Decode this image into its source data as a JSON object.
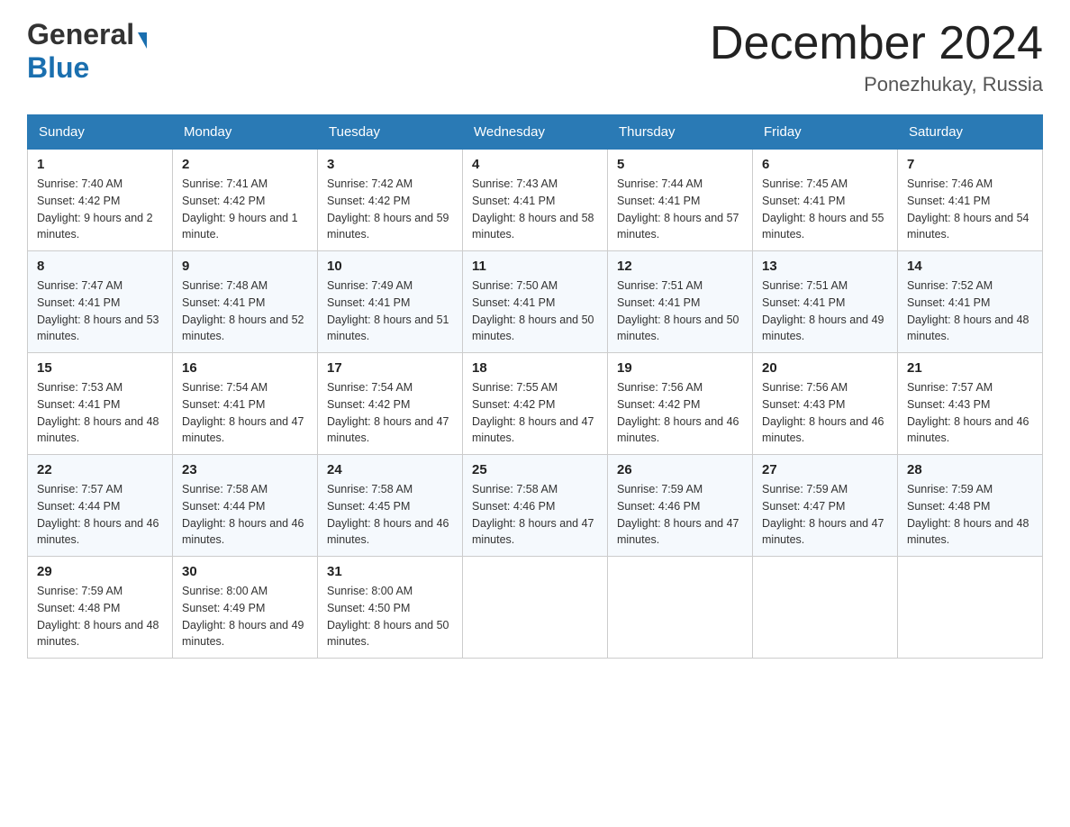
{
  "header": {
    "logo_general": "General",
    "logo_blue": "Blue",
    "month_title": "December 2024",
    "location": "Ponezhukay, Russia"
  },
  "days_of_week": [
    "Sunday",
    "Monday",
    "Tuesday",
    "Wednesday",
    "Thursday",
    "Friday",
    "Saturday"
  ],
  "weeks": [
    [
      {
        "day": "1",
        "sunrise": "7:40 AM",
        "sunset": "4:42 PM",
        "daylight": "9 hours and 2 minutes."
      },
      {
        "day": "2",
        "sunrise": "7:41 AM",
        "sunset": "4:42 PM",
        "daylight": "9 hours and 1 minute."
      },
      {
        "day": "3",
        "sunrise": "7:42 AM",
        "sunset": "4:42 PM",
        "daylight": "8 hours and 59 minutes."
      },
      {
        "day": "4",
        "sunrise": "7:43 AM",
        "sunset": "4:41 PM",
        "daylight": "8 hours and 58 minutes."
      },
      {
        "day": "5",
        "sunrise": "7:44 AM",
        "sunset": "4:41 PM",
        "daylight": "8 hours and 57 minutes."
      },
      {
        "day": "6",
        "sunrise": "7:45 AM",
        "sunset": "4:41 PM",
        "daylight": "8 hours and 55 minutes."
      },
      {
        "day": "7",
        "sunrise": "7:46 AM",
        "sunset": "4:41 PM",
        "daylight": "8 hours and 54 minutes."
      }
    ],
    [
      {
        "day": "8",
        "sunrise": "7:47 AM",
        "sunset": "4:41 PM",
        "daylight": "8 hours and 53 minutes."
      },
      {
        "day": "9",
        "sunrise": "7:48 AM",
        "sunset": "4:41 PM",
        "daylight": "8 hours and 52 minutes."
      },
      {
        "day": "10",
        "sunrise": "7:49 AM",
        "sunset": "4:41 PM",
        "daylight": "8 hours and 51 minutes."
      },
      {
        "day": "11",
        "sunrise": "7:50 AM",
        "sunset": "4:41 PM",
        "daylight": "8 hours and 50 minutes."
      },
      {
        "day": "12",
        "sunrise": "7:51 AM",
        "sunset": "4:41 PM",
        "daylight": "8 hours and 50 minutes."
      },
      {
        "day": "13",
        "sunrise": "7:51 AM",
        "sunset": "4:41 PM",
        "daylight": "8 hours and 49 minutes."
      },
      {
        "day": "14",
        "sunrise": "7:52 AM",
        "sunset": "4:41 PM",
        "daylight": "8 hours and 48 minutes."
      }
    ],
    [
      {
        "day": "15",
        "sunrise": "7:53 AM",
        "sunset": "4:41 PM",
        "daylight": "8 hours and 48 minutes."
      },
      {
        "day": "16",
        "sunrise": "7:54 AM",
        "sunset": "4:41 PM",
        "daylight": "8 hours and 47 minutes."
      },
      {
        "day": "17",
        "sunrise": "7:54 AM",
        "sunset": "4:42 PM",
        "daylight": "8 hours and 47 minutes."
      },
      {
        "day": "18",
        "sunrise": "7:55 AM",
        "sunset": "4:42 PM",
        "daylight": "8 hours and 47 minutes."
      },
      {
        "day": "19",
        "sunrise": "7:56 AM",
        "sunset": "4:42 PM",
        "daylight": "8 hours and 46 minutes."
      },
      {
        "day": "20",
        "sunrise": "7:56 AM",
        "sunset": "4:43 PM",
        "daylight": "8 hours and 46 minutes."
      },
      {
        "day": "21",
        "sunrise": "7:57 AM",
        "sunset": "4:43 PM",
        "daylight": "8 hours and 46 minutes."
      }
    ],
    [
      {
        "day": "22",
        "sunrise": "7:57 AM",
        "sunset": "4:44 PM",
        "daylight": "8 hours and 46 minutes."
      },
      {
        "day": "23",
        "sunrise": "7:58 AM",
        "sunset": "4:44 PM",
        "daylight": "8 hours and 46 minutes."
      },
      {
        "day": "24",
        "sunrise": "7:58 AM",
        "sunset": "4:45 PM",
        "daylight": "8 hours and 46 minutes."
      },
      {
        "day": "25",
        "sunrise": "7:58 AM",
        "sunset": "4:46 PM",
        "daylight": "8 hours and 47 minutes."
      },
      {
        "day": "26",
        "sunrise": "7:59 AM",
        "sunset": "4:46 PM",
        "daylight": "8 hours and 47 minutes."
      },
      {
        "day": "27",
        "sunrise": "7:59 AM",
        "sunset": "4:47 PM",
        "daylight": "8 hours and 47 minutes."
      },
      {
        "day": "28",
        "sunrise": "7:59 AM",
        "sunset": "4:48 PM",
        "daylight": "8 hours and 48 minutes."
      }
    ],
    [
      {
        "day": "29",
        "sunrise": "7:59 AM",
        "sunset": "4:48 PM",
        "daylight": "8 hours and 48 minutes."
      },
      {
        "day": "30",
        "sunrise": "8:00 AM",
        "sunset": "4:49 PM",
        "daylight": "8 hours and 49 minutes."
      },
      {
        "day": "31",
        "sunrise": "8:00 AM",
        "sunset": "4:50 PM",
        "daylight": "8 hours and 50 minutes."
      },
      null,
      null,
      null,
      null
    ]
  ],
  "colors": {
    "header_bg": "#2a7ab5",
    "logo_blue": "#1a6faf"
  }
}
